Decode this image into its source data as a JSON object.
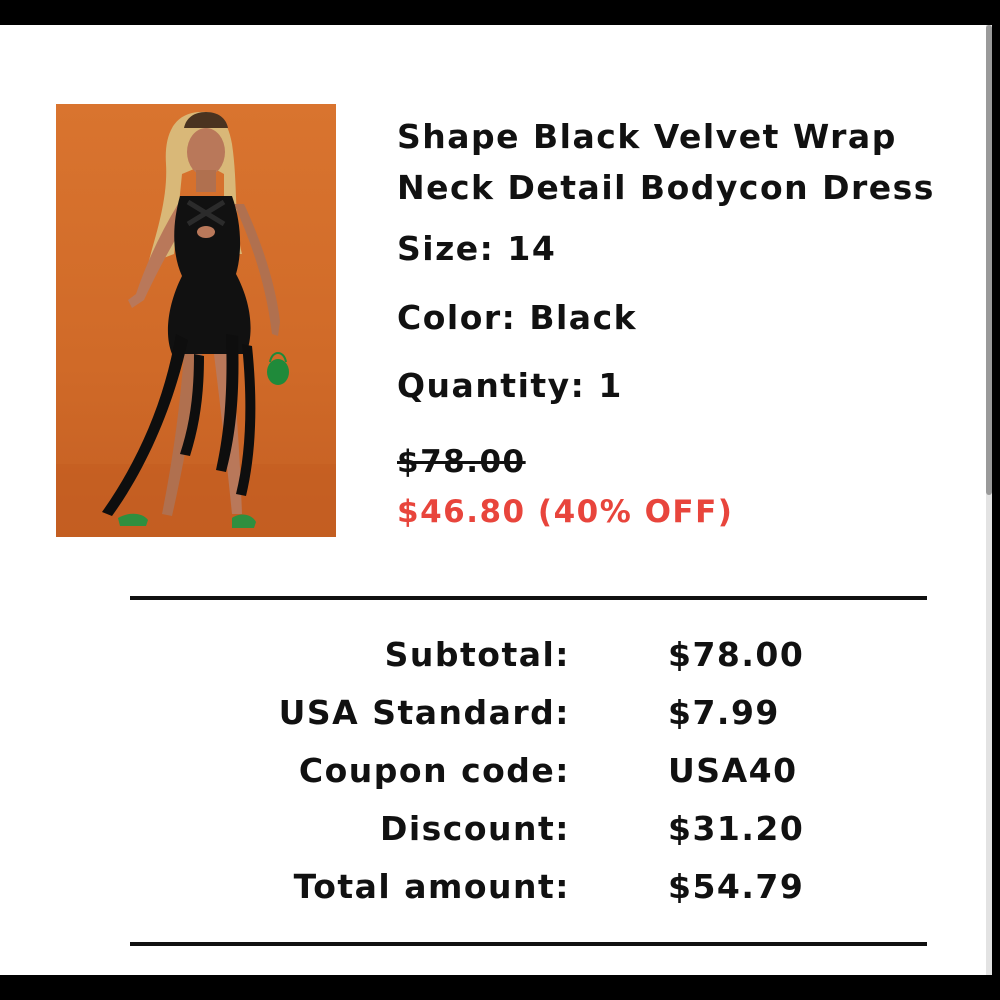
{
  "product": {
    "title": "Shape Black Velvet Wrap Neck Detail Bodycon Dress",
    "size": "Size: 14",
    "color": "Color: Black",
    "quantity": "Quantity: 1",
    "original_price": "$78.00",
    "sale_price": "$46.80 (40% OFF)",
    "image_icon": "dress-photo",
    "sale_color": "#e8453c",
    "image_background": "#d06a28"
  },
  "summary": {
    "rows": [
      {
        "label": "Subtotal:",
        "value": "$78.00"
      },
      {
        "label": "USA Standard:",
        "value": "$7.99"
      },
      {
        "label": "Coupon code:",
        "value": "USA40"
      },
      {
        "label": "Discount:",
        "value": "$31.20"
      },
      {
        "label": "Total amount:",
        "value": "$54.79"
      }
    ]
  }
}
